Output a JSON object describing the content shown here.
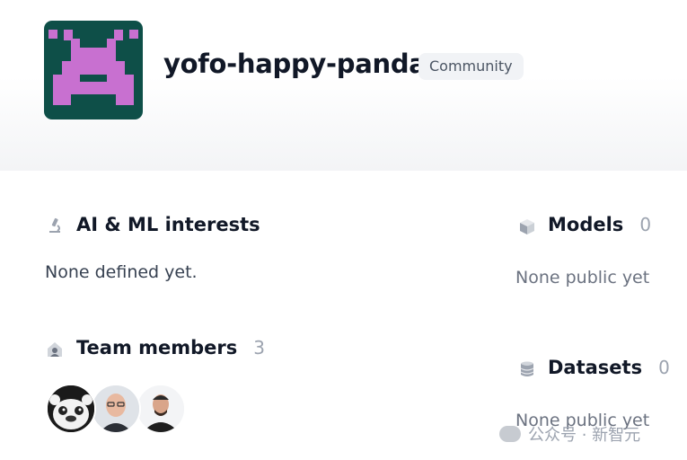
{
  "org": {
    "name": "yofo-happy-panda",
    "badge": "Community",
    "avatar_bg": "#0e4f48",
    "avatar_fg": "#c870d0"
  },
  "interests": {
    "title": "AI & ML interests",
    "value": "None defined yet."
  },
  "team": {
    "title": "Team members",
    "count": "3",
    "members": [
      "member-1",
      "member-2",
      "member-3"
    ]
  },
  "models": {
    "title": "Models",
    "count": "0",
    "empty": "None public yet"
  },
  "datasets": {
    "title": "Datasets",
    "count": "0",
    "empty": "None public yet"
  },
  "watermark": "公众号 · 新智元",
  "icons": [
    "microscope-icon",
    "team-icon",
    "cube-icon",
    "database-icon"
  ]
}
